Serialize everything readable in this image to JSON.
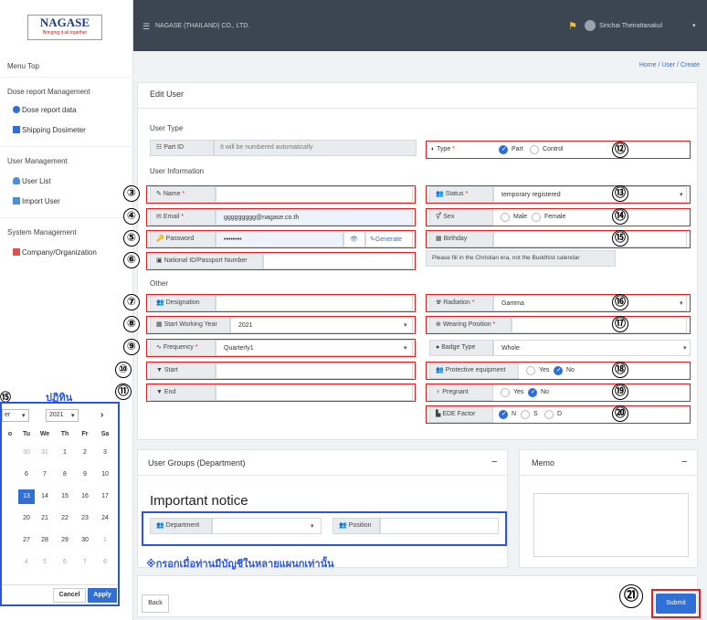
{
  "header": {
    "logo_text": "NAGASE",
    "logo_tagline": "Bringing it all together",
    "company_name": "NAGASE (THAILAND) CO., LTD.",
    "user_name": "Sirichai Theirattanakul",
    "breadcrumb": "Home / User / Create"
  },
  "sidebar": {
    "menu_top": "Menu Top",
    "dose_section": "Dose report Management",
    "dose_report_data": "Dose report data",
    "shipping_dosimeter": "Shipping Dosimeter",
    "user_section": "User Management",
    "user_list": "User List",
    "import_user": "Import User",
    "system_section": "System Management",
    "company_org": "Company/Organization"
  },
  "form": {
    "title": "Edit User",
    "user_type_section": "User Type",
    "part_id_label": "Part ID",
    "part_id_placeholder": "It will be numbered automatically",
    "type_label": "Type",
    "type_opt1": "Part",
    "type_opt2": "Control",
    "user_info_section": "User Information",
    "name_label": "Name",
    "status_label": "Status",
    "status_value": "temporary registered",
    "email_label": "Email",
    "email_value": "ggggggggg@nagase.co.th",
    "sex_label": "Sex",
    "sex_opt1": "Male",
    "sex_opt2": "Female",
    "password_label": "Password",
    "password_value": "••••••••",
    "generate_label": "Generate",
    "birthday_label": "Birthday",
    "birthday_hint": "Please fill in the Christian era, not the Buddhist calendar",
    "national_id_label": "National ID/Passport Number",
    "other_section": "Other",
    "designation_label": "Designation",
    "radiation_label": "Radiation",
    "radiation_value": "Gamma",
    "start_year_label": "Start Working Year",
    "start_year_value": "2021",
    "wearing_position_label": "Wearing Position",
    "frequency_label": "Frequency",
    "frequency_value": "Quarterly1",
    "badge_type_label": "Badge Type",
    "badge_type_value": "Whole",
    "start_label": "Start",
    "protective_label": "Protective equipment",
    "yes": "Yes",
    "no": "No",
    "end_label": "End",
    "pregnant_label": "Pregnant",
    "ede_label": "EDE Factor",
    "ede_opt1": "N",
    "ede_opt2": "S",
    "ede_opt3": "D"
  },
  "groups": {
    "title": "User Groups (Department)",
    "notice": "Important notice",
    "department_label": "Department",
    "position_label": "Position",
    "thai_note": "※กรอกเมื่อท่านมีบัญชีในหลายแผนกเท่านั้น"
  },
  "memo": {
    "title": "Memo"
  },
  "buttons": {
    "back": "Back",
    "submit": "Submit"
  },
  "calendar": {
    "label_num": "⑮",
    "thai_label": "ปฏิทิน",
    "month": "er",
    "year": "2021",
    "days": [
      "o",
      "Tu",
      "We",
      "Th",
      "Fr",
      "Sa"
    ],
    "rows": [
      [
        "",
        "30",
        "31",
        "1",
        "2",
        "3"
      ],
      [
        "",
        "6",
        "7",
        "8",
        "9",
        "10"
      ],
      [
        "",
        "13",
        "14",
        "15",
        "16",
        "17"
      ],
      [
        "",
        "20",
        "21",
        "22",
        "23",
        "24"
      ],
      [
        "",
        "27",
        "28",
        "29",
        "30",
        "1"
      ],
      [
        "",
        "4",
        "5",
        "6",
        "7",
        "8"
      ]
    ],
    "cancel": "Cancel",
    "apply": "Apply"
  },
  "annotations": [
    "③",
    "④",
    "⑤",
    "⑥",
    "⑦",
    "⑧",
    "⑨",
    "⑩",
    "⑪",
    "⑫",
    "⑬",
    "⑭",
    "⑮",
    "⑯",
    "⑰",
    "⑱",
    "⑲",
    "⑳",
    "㉑"
  ],
  "colors": {
    "accent": "#2f6fd6",
    "annotation_red": "#e02020",
    "annotation_blue": "#2a56d9",
    "topbar": "#3b4652"
  }
}
